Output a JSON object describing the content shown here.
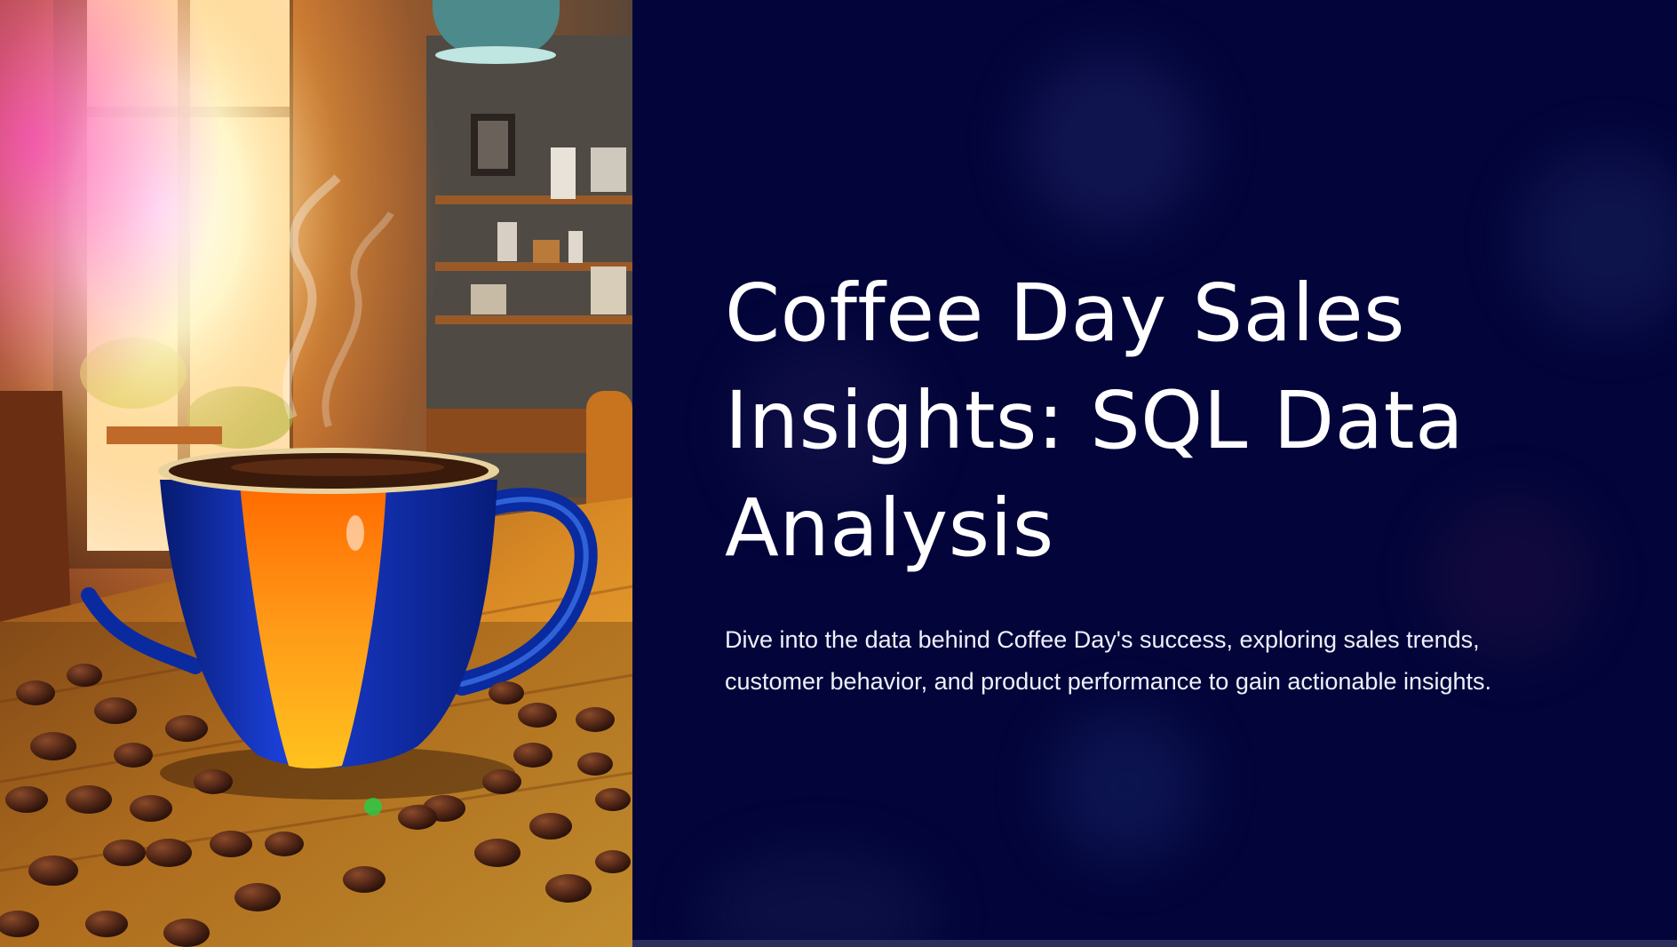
{
  "slide": {
    "title": "Coffee Day Sales Insights: SQL Data Analysis",
    "subtitle": "Dive into the data behind Coffee Day's success, exploring sales trends, customer behavior, and product performance to gain actionable insights."
  },
  "image": {
    "description_icon": "coffee-cup-illustration"
  },
  "colors": {
    "background": "#03053a",
    "title": "#ffffff",
    "subtitle": "#eef0fb",
    "cup_blue": "#0b2a9e",
    "cup_orange": "#ff8a10",
    "table_wood": "#c9781f"
  }
}
